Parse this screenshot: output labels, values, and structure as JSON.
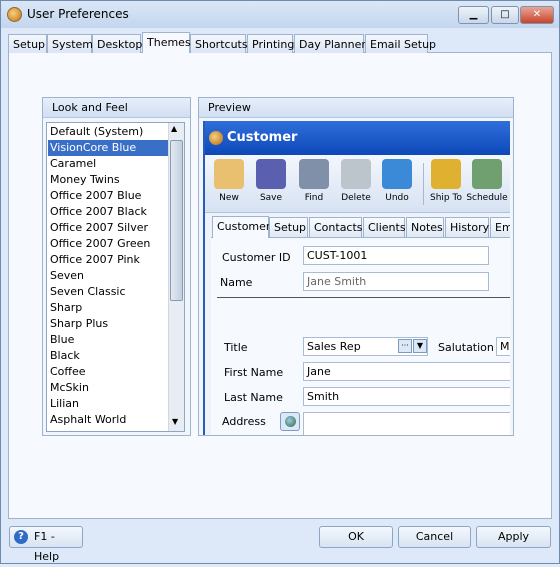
{
  "window": {
    "title": "User Preferences",
    "minimize": "▁",
    "maximize": "□",
    "close": "✕"
  },
  "tabs": [
    {
      "label": "Setup"
    },
    {
      "label": "System"
    },
    {
      "label": "Desktop"
    },
    {
      "label": "Themes",
      "active": true
    },
    {
      "label": "Shortcuts"
    },
    {
      "label": "Printing"
    },
    {
      "label": "Day Planner"
    },
    {
      "label": "Email Setup"
    }
  ],
  "look_and_feel": {
    "header": "Look and Feel",
    "selected": "VisionCore Blue",
    "items": [
      "Default (System)",
      "VisionCore Blue",
      "Caramel",
      "Money Twins",
      "Office 2007 Blue",
      "Office 2007 Black",
      "Office 2007 Silver",
      "Office 2007 Green",
      "Office 2007 Pink",
      "Seven",
      "Seven Classic",
      "Sharp",
      "Sharp Plus",
      "Blue",
      "Black",
      "Coffee",
      "McSkin",
      "Lilian",
      "Asphalt World"
    ]
  },
  "preview": {
    "header": "Preview",
    "customer_window": {
      "title": "Customer",
      "toolbar": [
        {
          "label": "New",
          "icon": "new-card-icon",
          "color": "#e8c070"
        },
        {
          "label": "Save",
          "icon": "floppy-disk-icon",
          "color": "#5a5fb0"
        },
        {
          "label": "Find",
          "icon": "binoculars-icon",
          "color": "#8090a8"
        },
        {
          "label": "Delete",
          "icon": "recycle-bin-icon",
          "color": "#bcc4cc"
        },
        {
          "label": "Undo",
          "icon": "undo-arrow-icon",
          "color": "#3a8ad8"
        },
        {
          "label": "Ship To",
          "icon": "forklift-icon",
          "color": "#e0b030"
        },
        {
          "label": "Schedule",
          "icon": "calendar-clock-icon",
          "color": "#70a070"
        }
      ],
      "tabs": [
        "Customer",
        "Setup",
        "Contacts",
        "Clients",
        "Notes",
        "History",
        "Ema"
      ],
      "form": {
        "customer_id_label": "Customer ID",
        "customer_id": "CUST-1001",
        "name_label": "Name",
        "name": "Jane Smith",
        "title_label": "Title",
        "title": "Sales Rep",
        "salutation_label": "Salutation",
        "salutation": "Mr",
        "first_name_label": "First Name",
        "first_name": "Jane",
        "last_name_label": "Last Name",
        "last_name": "Smith",
        "address_label": "Address",
        "address": ""
      }
    }
  },
  "footer": {
    "help": "F1 - Help",
    "ok": "OK",
    "cancel": "Cancel",
    "apply": "Apply"
  }
}
